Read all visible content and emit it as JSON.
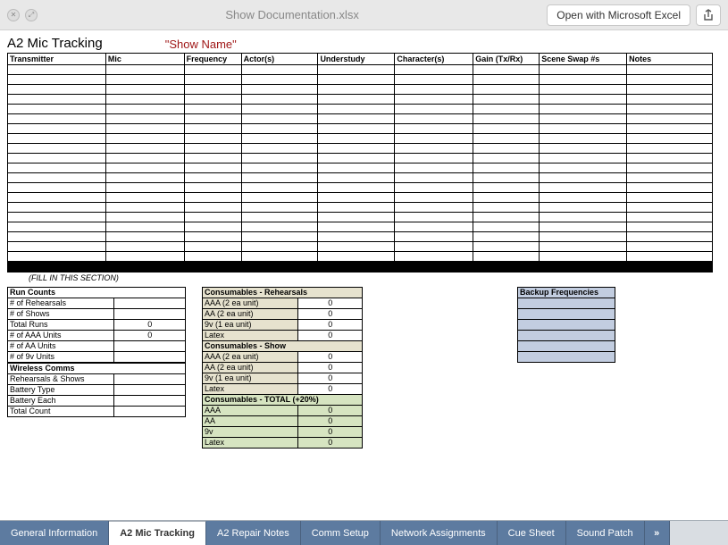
{
  "toolbar": {
    "doc_title": "Show Documentation.xlsx",
    "open_label": "Open with Microsoft Excel"
  },
  "page": {
    "title": "A2 Mic Tracking",
    "show_name": "\"Show Name\""
  },
  "mic_headers": [
    "Transmitter",
    "Mic",
    "Frequency",
    "Actor(s)",
    "Understudy",
    "Character(s)",
    "Gain (Tx/Rx)",
    "Scene Swap #s",
    "Notes"
  ],
  "mic_col_widths": [
    110,
    88,
    64,
    86,
    86,
    88,
    74,
    98,
    96
  ],
  "mic_blank_rows": 20,
  "section_note": "(FILL IN THIS SECTION)",
  "run_counts": {
    "header": "Run Counts",
    "rows": [
      {
        "label": "# of Rehearsals",
        "value": ""
      },
      {
        "label": "# of Shows",
        "value": ""
      },
      {
        "label": "Total Runs",
        "value": "0"
      },
      {
        "label": "# of AAA Units",
        "value": "0"
      },
      {
        "label": "# of AA Units",
        "value": ""
      },
      {
        "label": "# of 9v Units",
        "value": ""
      }
    ]
  },
  "wireless": {
    "header": "Wireless Comms",
    "rows": [
      {
        "label": "Rehearsals & Shows",
        "value": ""
      },
      {
        "label": "Battery Type",
        "value": ""
      },
      {
        "label": "Battery Each",
        "value": ""
      },
      {
        "label": "Total Count",
        "value": ""
      }
    ]
  },
  "consumables_rehearsals": {
    "header": "Consumables - Rehearsals",
    "rows": [
      {
        "label": "AAA (2 ea unit)",
        "value": "0"
      },
      {
        "label": "AA (2 ea unit)",
        "value": "0"
      },
      {
        "label": "9v (1 ea unit)",
        "value": "0"
      },
      {
        "label": "Latex",
        "value": "0"
      }
    ]
  },
  "consumables_show": {
    "header": "Consumables - Show",
    "rows": [
      {
        "label": "AAA (2 ea unit)",
        "value": "0"
      },
      {
        "label": "AA (2 ea unit)",
        "value": "0"
      },
      {
        "label": "9v (1 ea unit)",
        "value": "0"
      },
      {
        "label": "Latex",
        "value": "0"
      }
    ]
  },
  "consumables_total": {
    "header": "Consumables - TOTAL (+20%)",
    "rows": [
      {
        "label": "AAA",
        "value": "0"
      },
      {
        "label": "AA",
        "value": "0"
      },
      {
        "label": "9v",
        "value": "0"
      },
      {
        "label": "Latex",
        "value": "0"
      }
    ]
  },
  "backup_freq": {
    "header": "Backup Frequencies",
    "blank_rows": 6
  },
  "tabs": [
    {
      "label": "General Information",
      "active": false
    },
    {
      "label": "A2 Mic Tracking",
      "active": true
    },
    {
      "label": "A2 Repair Notes",
      "active": false
    },
    {
      "label": "Comm Setup",
      "active": false
    },
    {
      "label": "Network Assignments",
      "active": false
    },
    {
      "label": "Cue Sheet",
      "active": false
    },
    {
      "label": "Sound Patch",
      "active": false
    }
  ]
}
